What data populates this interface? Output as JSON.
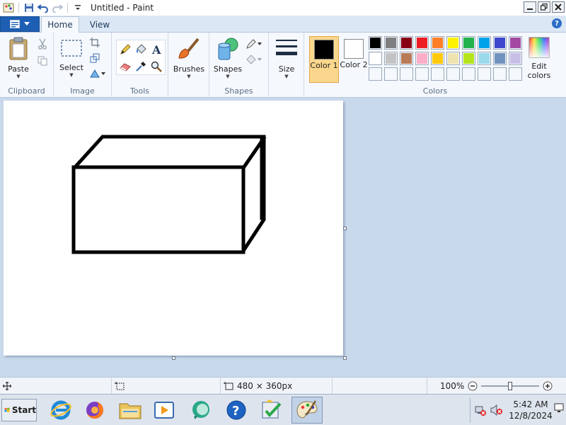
{
  "window": {
    "title": "Untitled - Paint"
  },
  "tabs": {
    "home": "Home",
    "view": "View"
  },
  "clipboard": {
    "paste": "Paste",
    "group": "Clipboard"
  },
  "image": {
    "select": "Select",
    "group": "Image"
  },
  "tools": {
    "group": "Tools"
  },
  "brushes": {
    "label": "Brushes"
  },
  "shapes": {
    "label": "Shapes",
    "group": "Shapes"
  },
  "size": {
    "label": "Size"
  },
  "colors": {
    "color1_label": "Color 1",
    "color2_label": "Color 2",
    "color1_value": "#000000",
    "color2_value": "#ffffff",
    "edit_label": "Edit colors",
    "group": "Colors",
    "palette_row1": [
      "#000000",
      "#7f7f7f",
      "#880015",
      "#ed1c24",
      "#ff7f27",
      "#fff200",
      "#22b14c",
      "#00a2e8",
      "#3f48cc",
      "#a349a4"
    ],
    "palette_row2": [
      "#ffffff",
      "#c3c3c3",
      "#b97a57",
      "#ffaec9",
      "#ffc90e",
      "#efe4b0",
      "#b5e61d",
      "#99d9ea",
      "#7092be",
      "#c8bfe7"
    ]
  },
  "status": {
    "image_size": "480 × 360px",
    "zoom": "100%"
  },
  "taskbar": {
    "start": "Start",
    "time": "5:42 AM",
    "date": "12/8/2024"
  }
}
